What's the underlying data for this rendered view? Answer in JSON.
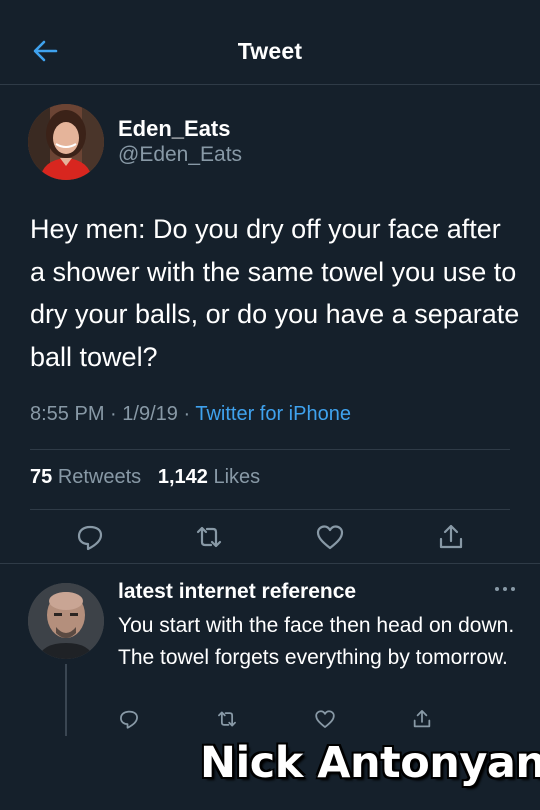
{
  "header": {
    "title": "Tweet",
    "back_icon": "arrow-left-icon",
    "accent_color": "#3fa2ee"
  },
  "tweet": {
    "display_name": "Eden_Eats",
    "handle": "@Eden_Eats",
    "text": "Hey men: Do you dry off your face after a shower with the same towel you use to dry your balls, or do you have a separate ball towel?",
    "time": "8:55 PM",
    "date": "1/9/19",
    "separator": "·",
    "source": "Twitter for iPhone",
    "retweets_count": "75",
    "retweets_label": "Retweets",
    "likes_count": "1,142",
    "likes_label": "Likes",
    "actions": [
      "reply-icon",
      "retweet-icon",
      "like-icon",
      "share-icon"
    ]
  },
  "reply": {
    "display_name": "latest internet reference",
    "text": "You start with the face then head on down. The towel forgets everything by tomorrow.",
    "more_icon": "more-horizontal-icon",
    "actions": [
      "reply-icon",
      "retweet-icon",
      "like-icon",
      "share-icon"
    ]
  },
  "watermark": "Nick Antonyan",
  "colors": {
    "background": "#15202b",
    "secondary_text": "#8899a6",
    "divider": "#2f3b47",
    "link": "#3fa2ee"
  }
}
